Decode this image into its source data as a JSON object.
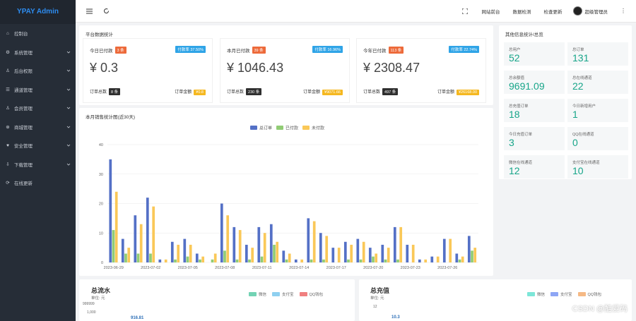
{
  "app": {
    "title": "YPAY Admin"
  },
  "sidebar": {
    "items": [
      {
        "label": "控制台",
        "icon": "home-icon"
      },
      {
        "label": "系统管理",
        "icon": "gear-icon"
      },
      {
        "label": "后台权限",
        "icon": "user-icon"
      },
      {
        "label": "通道管理",
        "icon": "list-icon"
      },
      {
        "label": "会员管理",
        "icon": "user-icon"
      },
      {
        "label": "商城管理",
        "icon": "shop-icon"
      },
      {
        "label": "安全管理",
        "icon": "heart-icon"
      },
      {
        "label": "下载管理",
        "icon": "download-icon"
      },
      {
        "label": "在线更新",
        "icon": "refresh-icon"
      }
    ]
  },
  "topbar": {
    "links": [
      "网站前台",
      "数据检测",
      "检查更新"
    ],
    "user": "超级管理员"
  },
  "platform_stats": {
    "title": "平台数据统计",
    "cards": [
      {
        "label": "今日已付款",
        "count_badge": "3 条",
        "rate": "付款率 37.50%",
        "amount": "¥ 0.3",
        "total_orders_label": "订单总数",
        "total_orders": "8 条",
        "total_amount_label": "订单金额",
        "total_amount": "¥0.8"
      },
      {
        "label": "本月已付款",
        "count_badge": "39 条",
        "rate": "付款率 16.96%",
        "amount": "¥ 1046.43",
        "total_orders_label": "订单总数",
        "total_orders": "230 条",
        "total_amount_label": "订单金额",
        "total_amount": "¥9071.66"
      },
      {
        "label": "今年已付款",
        "count_badge": "113 条",
        "rate": "付款率 22.74%",
        "amount": "¥ 2308.47",
        "total_orders_label": "订单总数",
        "total_orders": "497 条",
        "total_amount_label": "订单金额",
        "total_amount": "¥26168.00"
      }
    ]
  },
  "other_stats": {
    "title": "其他信息统计/总览",
    "items": [
      {
        "label": "总用户",
        "value": "52"
      },
      {
        "label": "总订单",
        "value": "131"
      },
      {
        "label": "总余额值",
        "value": "9691.09"
      },
      {
        "label": "总在线通道",
        "value": "22"
      },
      {
        "label": "总充值订单",
        "value": "18"
      },
      {
        "label": "今日新增用户",
        "value": "1"
      },
      {
        "label": "今日充值订单",
        "value": "3"
      },
      {
        "label": "QQ在线通道",
        "value": "0"
      },
      {
        "label": "微信在线通道",
        "value": "12"
      },
      {
        "label": "支付宝在线通道",
        "value": "10"
      }
    ]
  },
  "chart_data": {
    "type": "bar",
    "title": "本月销售统计图(近30天)",
    "series": [
      {
        "name": "总订单",
        "color": "#5470c6",
        "values": [
          35,
          8,
          16,
          22,
          1,
          7,
          8,
          3,
          0,
          20,
          12,
          6,
          12,
          13,
          4,
          1,
          15,
          10,
          5,
          7,
          8,
          5,
          6,
          12,
          6,
          1,
          2,
          8,
          3,
          9
        ]
      },
      {
        "name": "已付款",
        "color": "#91cc75",
        "values": [
          11,
          3,
          3,
          3,
          0,
          1,
          2,
          1,
          1,
          4,
          1,
          1,
          2,
          6,
          1,
          0,
          1,
          1,
          0,
          1,
          1,
          2,
          1,
          1,
          0,
          0,
          0,
          0,
          1,
          4
        ]
      },
      {
        "name": "未付款",
        "color": "#fac858",
        "values": [
          24,
          5,
          13,
          19,
          1,
          6,
          6,
          2,
          3,
          16,
          11,
          5,
          10,
          7,
          3,
          1,
          14,
          9,
          5,
          6,
          7,
          3,
          5,
          12,
          6,
          1,
          2,
          8,
          2,
          5
        ]
      }
    ],
    "xlabels": [
      "2023-06-29",
      "2023-07-02",
      "2023-07-05",
      "2023-07-08",
      "2023-07-11",
      "2023-07-14",
      "2023-07-17",
      "2023-07-20",
      "2023-07-23",
      "2023-07-26"
    ],
    "ylim": [
      0,
      40
    ],
    "yticks": [
      "0",
      "10",
      "20",
      "30",
      "40"
    ],
    "grid": true,
    "legend": "top-center"
  },
  "flow": {
    "title": "总流水",
    "unit": "单位: 元",
    "legend": [
      {
        "name": "微信",
        "color": "#73d3b4"
      },
      {
        "name": "支付宝",
        "color": "#8fd0f0"
      },
      {
        "name": "QQ钱包",
        "color": "#f08080"
      }
    ],
    "ytick_top": "999999",
    "ytick_2": "1,000",
    "value_label": "916.81"
  },
  "recharge": {
    "title": "总充值",
    "unit": "单位: 元",
    "legend": [
      {
        "name": "微信",
        "color": "#7de6d8"
      },
      {
        "name": "支付宝",
        "color": "#8ea6f5"
      },
      {
        "name": "QQ钱包",
        "color": "#f5b985"
      }
    ],
    "ytick_top": "12",
    "value_label": "10.3"
  },
  "watermark": "CSDN @酷爱码"
}
